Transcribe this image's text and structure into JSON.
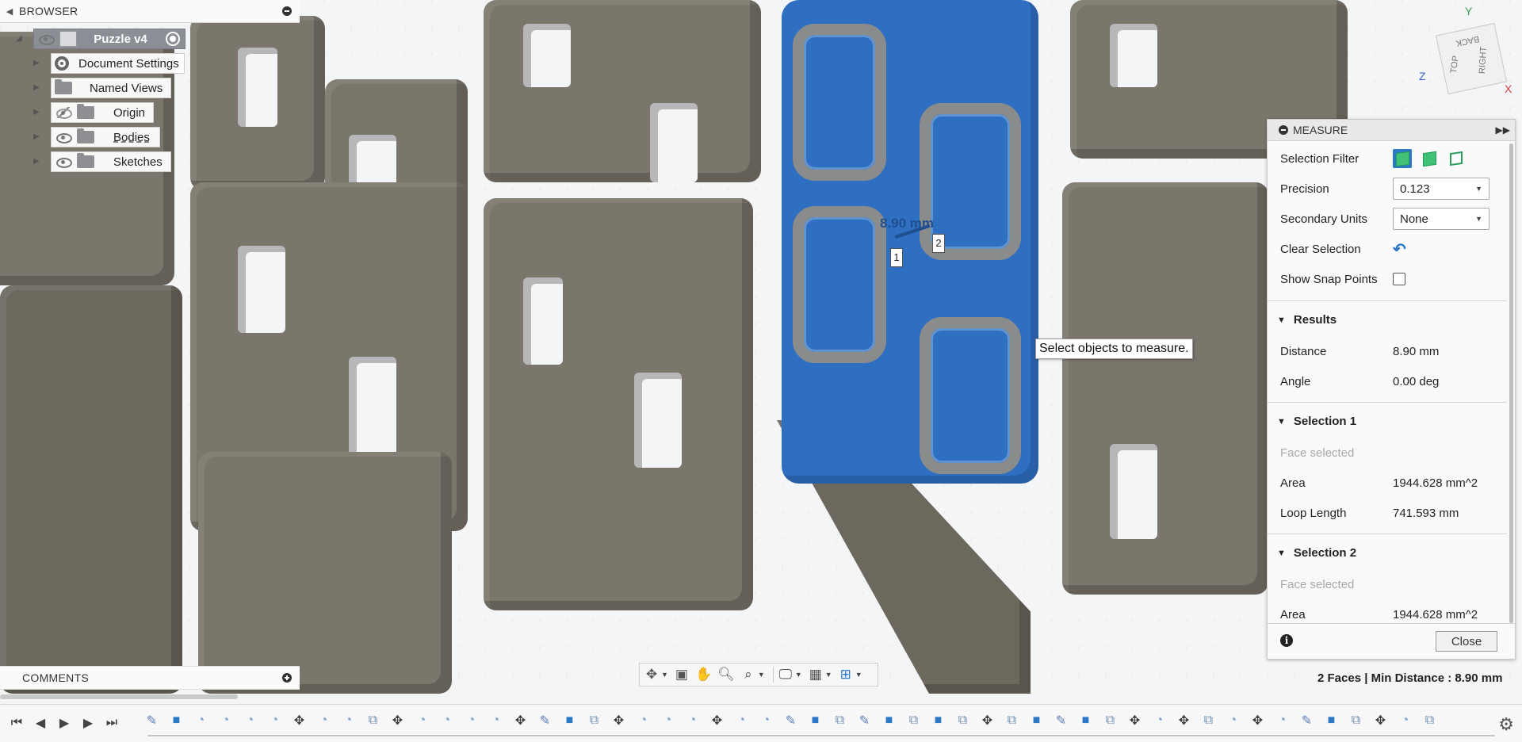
{
  "browser": {
    "title": "BROWSER",
    "items": [
      {
        "label": "Puzzle v4"
      },
      {
        "label": "Document Settings"
      },
      {
        "label": "Named Views"
      },
      {
        "label": "Origin"
      },
      {
        "label": "Bodies"
      },
      {
        "label": "Sketches"
      }
    ]
  },
  "comments": {
    "title": "COMMENTS"
  },
  "viewport": {
    "dimension_label": "8.90 mm",
    "selection_tags": [
      "1",
      "2"
    ],
    "tooltip": "Select objects to measure.",
    "status": "2 Faces | Min Distance : 8.90 mm",
    "viewcube": {
      "top": "BACK",
      "front": "TOP",
      "right": "RIGHT",
      "axes": [
        "Y",
        "Z",
        "X"
      ]
    }
  },
  "measure": {
    "title": "MEASURE",
    "selection_filter_label": "Selection Filter",
    "precision_label": "Precision",
    "precision_value": "0.123",
    "secondary_units_label": "Secondary Units",
    "secondary_units_value": "None",
    "clear_selection_label": "Clear Selection",
    "show_snap_points_label": "Show Snap Points",
    "show_snap_points_checked": false,
    "results": {
      "title": "Results",
      "distance_label": "Distance",
      "distance_value": "8.90 mm",
      "angle_label": "Angle",
      "angle_value": "0.00 deg"
    },
    "selection1": {
      "title": "Selection 1",
      "status": "Face selected",
      "area_label": "Area",
      "area_value": "1944.628 mm^2",
      "loop_label": "Loop Length",
      "loop_value": "741.593 mm"
    },
    "selection2": {
      "title": "Selection 2",
      "status": "Face selected",
      "area_label": "Area",
      "area_value": "1944.628 mm^2"
    },
    "close_label": "Close"
  },
  "colors": {
    "selection_blue": "#2e6fc2",
    "body_gray": "#7b766b",
    "accent": "#2b78c6"
  }
}
